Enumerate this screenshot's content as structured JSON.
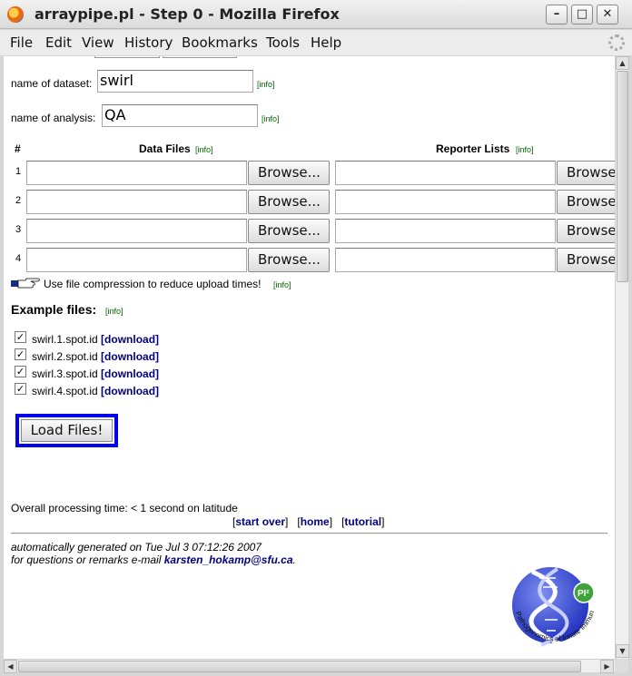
{
  "window": {
    "title": "arraypipe.pl - Step 0 - Mozilla Firefox",
    "minimize": "–",
    "maximize": "□",
    "close": "✕"
  },
  "menu": [
    "File",
    "Edit",
    "View",
    "History",
    "Bookmarks",
    "Tools",
    "Help"
  ],
  "form": {
    "dataset_label": "name of dataset:",
    "dataset_value": "swirl",
    "analysis_label": "name of analysis:",
    "analysis_value": "QA",
    "info": "[info]",
    "col_hash": "#",
    "col_data": "Data Files",
    "col_reporter": "Reporter Lists",
    "rows": [
      "1",
      "2",
      "3",
      "4"
    ],
    "browse_label": "Browse...",
    "compression_hint": "Use file compression to reduce upload times!"
  },
  "examples": {
    "title": "Example files:",
    "files": [
      "swirl.1.spot.id",
      "swirl.2.spot.id",
      "swirl.3.spot.id",
      "swirl.4.spot.id"
    ],
    "checked": [
      true,
      true,
      true,
      true
    ],
    "download": "[download]"
  },
  "load_button": "Load Files!",
  "footer": {
    "processing": "Overall processing time: < 1 second on latitude",
    "links": [
      "start over",
      "home",
      "tutorial"
    ],
    "generated": "automatically generated on Tue Jul 3 07:12:26 2007",
    "questions_prefix": "for questions or remarks e-mail ",
    "email": "karsten_hokamp@sfu.ca",
    "questions_suffix": "."
  },
  "logo": {
    "text": "Pathogenomics of Innate Immunity",
    "badge": "PI²"
  },
  "colors": {
    "link": "#000080",
    "info": "#006600",
    "focus": "#0000ee"
  }
}
